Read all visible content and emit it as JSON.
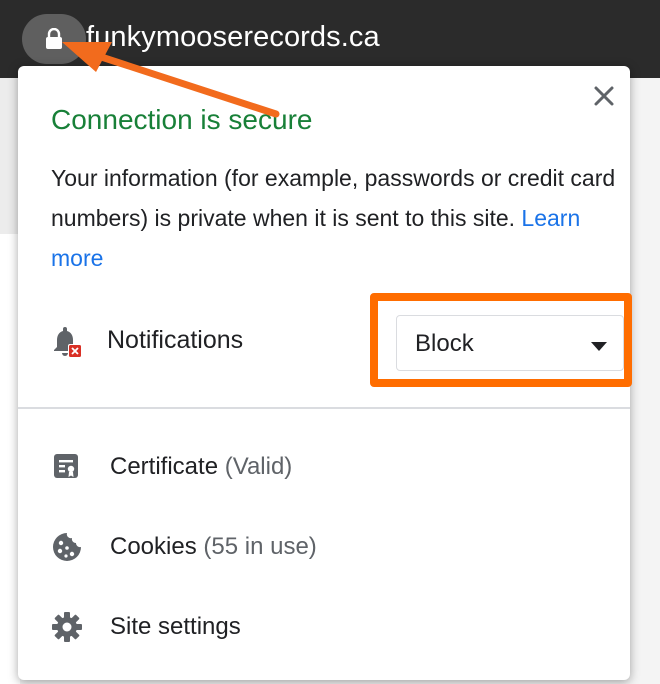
{
  "browser": {
    "url": "funkymooserecords.ca",
    "lock_icon": "lock-icon"
  },
  "popup": {
    "title": "Connection is secure",
    "description": "Your information (for example, passwords or credit card numbers) is private when it is sent to this site.",
    "learn_more": "Learn more",
    "close_icon": "close-icon",
    "title_color": "#188038",
    "link_color": "#1a73e8"
  },
  "notifications": {
    "label": "Notifications",
    "icon": "notifications-blocked-icon",
    "select_value": "Block",
    "highlight_color": "#ff6d00"
  },
  "menu": {
    "certificate": {
      "label": "Certificate",
      "status": "(Valid)",
      "icon": "certificate-icon"
    },
    "cookies": {
      "label": "Cookies",
      "status": "(55 in use)",
      "icon": "cookie-icon"
    },
    "site_settings": {
      "label": "Site settings",
      "icon": "gear-icon"
    }
  },
  "annotation": {
    "arrow_color": "#f26b1d"
  }
}
